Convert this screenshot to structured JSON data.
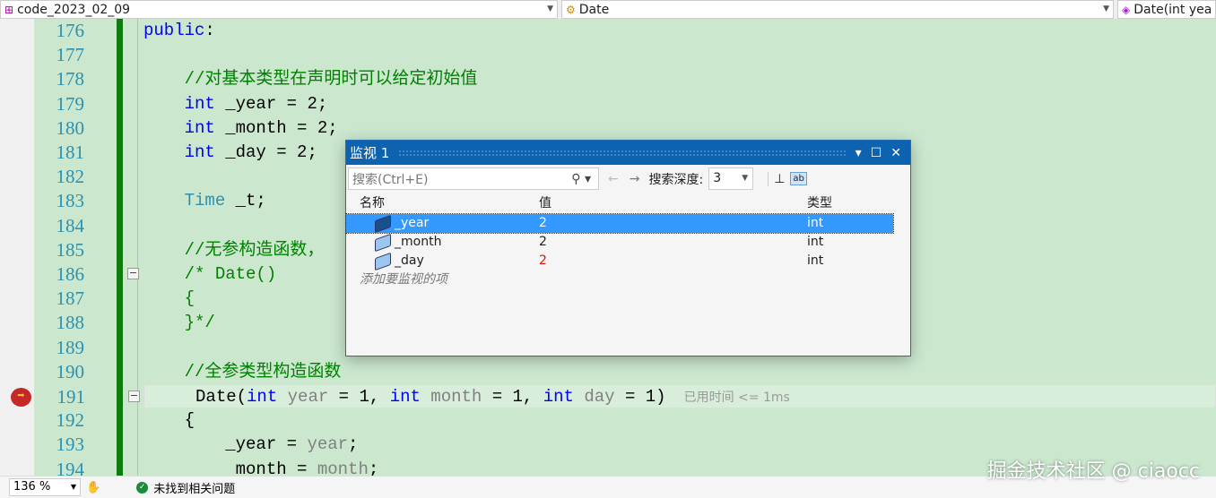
{
  "navbar": {
    "project": "code_2023_02_09",
    "scope": "Date",
    "member": "Date(int yea"
  },
  "lines": [
    {
      "n": "176",
      "parts": [
        [
          "kw",
          "public"
        ],
        [
          "tx",
          ":"
        ]
      ]
    },
    {
      "n": "177",
      "parts": []
    },
    {
      "n": "178",
      "parts": [
        [
          "tx",
          "    "
        ],
        [
          "cm",
          "//对基本类型在声明时可以给定初始值"
        ]
      ]
    },
    {
      "n": "179",
      "parts": [
        [
          "tx",
          "    "
        ],
        [
          "kw",
          "int"
        ],
        [
          "tx",
          " _year = 2;"
        ]
      ]
    },
    {
      "n": "180",
      "parts": [
        [
          "tx",
          "    "
        ],
        [
          "kw",
          "int"
        ],
        [
          "tx",
          " _month = 2;"
        ]
      ]
    },
    {
      "n": "181",
      "parts": [
        [
          "tx",
          "    "
        ],
        [
          "kw",
          "int"
        ],
        [
          "tx",
          " _day = 2;"
        ]
      ]
    },
    {
      "n": "182",
      "parts": []
    },
    {
      "n": "183",
      "parts": [
        [
          "tx",
          "    "
        ],
        [
          "ty",
          "Time"
        ],
        [
          "tx",
          " _t;"
        ]
      ]
    },
    {
      "n": "184",
      "parts": []
    },
    {
      "n": "185",
      "parts": [
        [
          "tx",
          "    "
        ],
        [
          "cm",
          "//无参构造函数，"
        ]
      ]
    },
    {
      "n": "186",
      "parts": [
        [
          "tx",
          "    "
        ],
        [
          "cm",
          "/* Date()"
        ]
      ]
    },
    {
      "n": "187",
      "parts": [
        [
          "tx",
          "    "
        ],
        [
          "cm",
          "{"
        ]
      ]
    },
    {
      "n": "188",
      "parts": [
        [
          "tx",
          "    "
        ],
        [
          "cm",
          "}*/"
        ]
      ]
    },
    {
      "n": "189",
      "parts": []
    },
    {
      "n": "190",
      "parts": [
        [
          "tx",
          "    "
        ],
        [
          "cm",
          "//全参类型构造函数"
        ]
      ]
    },
    {
      "n": "191",
      "parts": [
        [
          "tx",
          "     Date("
        ],
        [
          "kw",
          "int"
        ],
        [
          "pm",
          " year"
        ],
        [
          "tx",
          " = 1, "
        ],
        [
          "kw",
          "int"
        ],
        [
          "pm",
          " month"
        ],
        [
          "tx",
          " = 1, "
        ],
        [
          "kw",
          "int"
        ],
        [
          "pm",
          " day"
        ],
        [
          "tx",
          " = 1)"
        ]
      ]
    },
    {
      "n": "192",
      "parts": [
        [
          "tx",
          "    {"
        ]
      ]
    },
    {
      "n": "193",
      "parts": [
        [
          "tx",
          "        _year = "
        ],
        [
          "pm",
          "year"
        ],
        [
          "tx",
          ";"
        ]
      ]
    },
    {
      "n": "194",
      "parts": [
        [
          "tx",
          "         month = "
        ],
        [
          "pm",
          "month"
        ],
        [
          "tx",
          ";"
        ]
      ]
    }
  ],
  "perf_tip": "已用时间 <= 1ms",
  "watch": {
    "title": "监视 1",
    "search_placeholder": "搜索(Ctrl+E)",
    "depth_label": "搜索深度:",
    "depth": "3",
    "columns": [
      "名称",
      "值",
      "类型"
    ],
    "rows": [
      {
        "name": "_year",
        "value": "2",
        "type": "int"
      },
      {
        "name": "_month",
        "value": "2",
        "type": "int"
      },
      {
        "name": "_day",
        "value": "2",
        "type": "int"
      }
    ],
    "add_placeholder": "添加要监视的项"
  },
  "colors": {
    "changed_value": "#e51400"
  },
  "status": {
    "zoom": "136 %",
    "issues": "未找到相关问题"
  },
  "watermark": "掘金技术社区 @ ciaocc"
}
